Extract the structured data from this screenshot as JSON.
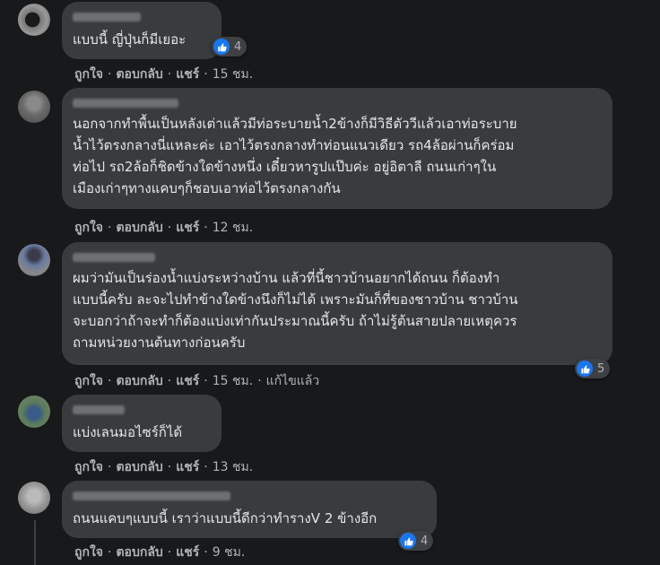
{
  "comments": [
    {
      "text": "แบบนี้ ญี่ปุ่นก็มีเยอะ",
      "like": "ถูกใจ",
      "reply": "ตอบกลับ",
      "share": "แชร์",
      "time": "15 ชม.",
      "reactions": "4"
    },
    {
      "text": "นอกจากทำพื้นเป็นหลังเต่าแล้วมีท่อระบายน้ำ2ข้างก็มีวิธีตัววีแล้วเอาท่อระบาย\nน้ำไว้ตรงกลางนี่แหละค่ะ เอาไว้ตรงกลางทำท่อนแนวเดียว รถ4ล้อผ่านก็คร่อม\nท่อไป รถ2ล้อก็ชิดข้างใดข้างหนึ่ง เดี๋ยวหารูปแป๊บค่ะ อยู่อิตาลี ถนนเก่าๆใน\nเมืองเก่าๆทางแคบๆก็ชอบเอาท่อไว้ตรงกลางกัน",
      "like": "ถูกใจ",
      "reply": "ตอบกลับ",
      "share": "แชร์",
      "time": "12 ชม."
    },
    {
      "text": "ผมว่ามันเป็นร่องน้ำแบ่งระหว่างบ้าน แล้วที่นี้ชาวบ้านอยากได้ถนน ก็ต้องทำ\nแบบนี้ครับ ละจะไปทำข้างใดข้างนึงก็ไม่ได้ เพราะมันก็ที่ของชาวบ้าน ชาวบ้าน\nจะบอกว่าถ้าจะทำก็ต้องแบ่งเท่ากันประมาณนี้ครับ ถ้าไม่รู้ต้นสายปลายเหตุควร\nถามหน่วยงานต้นทางก่อนครับ",
      "like": "ถูกใจ",
      "reply": "ตอบกลับ",
      "share": "แชร์",
      "time": "15 ชม.",
      "edited": "แก้ไขแล้ว",
      "reactions": "5"
    },
    {
      "text": "แบ่งเลนมอไซร์ก็ได้",
      "like": "ถูกใจ",
      "reply": "ตอบกลับ",
      "share": "แชร์",
      "time": "13 ชม."
    },
    {
      "text": "ถนนแคบๆแบบนี้ เราว่าแบบนี้ดีกว่าทำรางV 2 ข้างอีก",
      "like": "ถูกใจ",
      "reply": "ตอบกลับ",
      "share": "แชร์",
      "time": "9 ชม.",
      "reactions": "4"
    }
  ],
  "colors": {
    "background": "#18191a",
    "bubble": "#3a3b3c",
    "text": "#e4e6eb",
    "secondary_text": "#b0b3b8",
    "like_blue": "#1877f2"
  },
  "icons": {
    "reaction": "thumbs-up-icon"
  }
}
